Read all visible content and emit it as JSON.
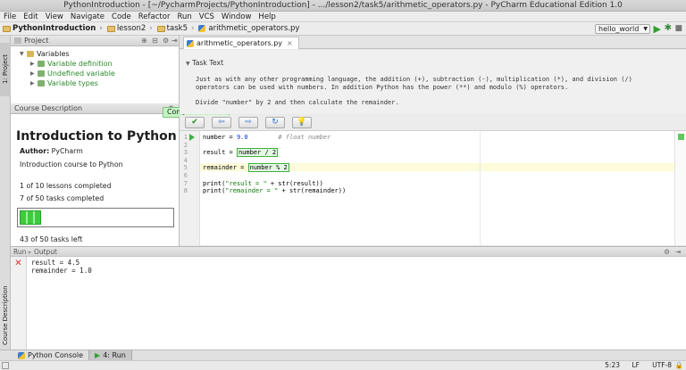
{
  "window": {
    "title": "PythonIntroduction - [~/PycharmProjects/PythonIntroduction] - .../lesson2/task5/arithmetic_operators.py - PyCharm Educational Edition 1.0"
  },
  "menu": [
    "File",
    "Edit",
    "View",
    "Navigate",
    "Code",
    "Refactor",
    "Run",
    "VCS",
    "Window",
    "Help"
  ],
  "breadcrumbs": [
    "PythonIntroduction",
    "lesson2",
    "task5",
    "arithmetic_operators.py"
  ],
  "run_config": "hello_world",
  "sidebar_tabs": {
    "project": "1: Project",
    "course": "Course Description"
  },
  "project": {
    "header": "Project",
    "tree": [
      {
        "label": "Variables",
        "level": 0,
        "expanded": true
      },
      {
        "label": "Variable definition",
        "level": 1
      },
      {
        "label": "Undefined variable",
        "level": 1
      },
      {
        "label": "Variable types",
        "level": 1
      }
    ]
  },
  "course": {
    "header": "Course Description",
    "title": "Introduction to Python",
    "author_label": "Author:",
    "author": "PyCharm",
    "description": "Introduction course to Python",
    "lessons": "1 of 10 lessons completed",
    "tasks": "7 of 50 tasks completed",
    "progress_fraction": 0.14,
    "tasks_left": "43 of 50 tasks left",
    "toast": "Congratulations!"
  },
  "editor": {
    "tab": "arithmetic_operators.py",
    "task_header": "Task Text",
    "task_lines": [
      "Just as with any other programming language, the addition (+), subtraction (-), multiplication (*), and division (/)",
      "operators can be used with numbers. In addition Python has the power (**) and modulo (%) operators.",
      "",
      "Divide \"number\" by 2 and then calculate the remainder."
    ],
    "line_numbers": [
      "1",
      "2",
      "3",
      "4",
      "5",
      "6",
      "7",
      "8"
    ],
    "code": {
      "l1_var": "number = ",
      "l1_num": "9.0",
      "l1_cmt": "# float number",
      "l3_var": "result = ",
      "l3_ph": "number / 2",
      "l5_var": "remainder = ",
      "l5_ph": "number % 2",
      "l7_a": "print(",
      "l7_str": "\"result = \"",
      "l7_b": " + str(result))",
      "l8_a": "print(",
      "l8_str": "\"remainder = \"",
      "l8_b": " + str(remainder))"
    }
  },
  "run_panel": {
    "header": "Run",
    "tab": "Output",
    "output": [
      "result = 4.5",
      "remainder = 1.0"
    ]
  },
  "bottom_tabs": {
    "console": "Python Console",
    "run": "4: Run"
  },
  "status": {
    "position": "5:23",
    "line_sep": "LF",
    "encoding": "UTF-8"
  }
}
